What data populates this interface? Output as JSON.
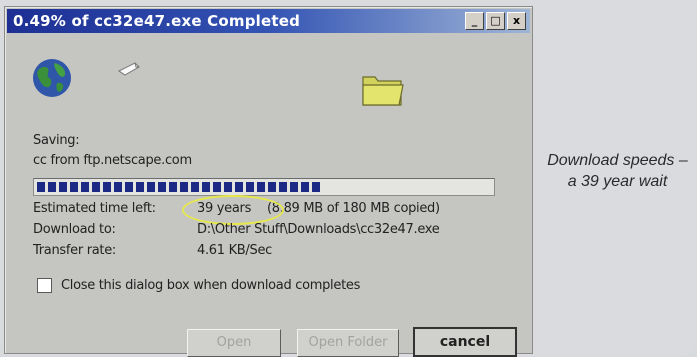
{
  "dialog": {
    "title": "0.49% of cc32e47.exe Completed",
    "window_buttons": [
      "_",
      "□",
      "x"
    ],
    "saving_label": "Saving:",
    "saving_source": "cc from ftp.netscape.com",
    "progress_fraction": 0.49,
    "fields": {
      "eta_label": "Estimated time left:",
      "eta_value": "39 years",
      "eta_detail": "(8.89 MB of 180 MB copied)",
      "download_to_label": "Download to:",
      "download_to_value": "D:\\Other Stuff\\Downloads\\cc32e47.exe",
      "transfer_rate_label": "Transfer rate:",
      "transfer_rate_value": "4.61 KB/Sec"
    },
    "checkbox": {
      "label": "Close this dialog box when download completes",
      "checked": false
    },
    "buttons": {
      "open": "Open",
      "open_folder": "Open Folder",
      "cancel": "cancel"
    },
    "icons": [
      "globe-icon",
      "document-icon",
      "folder-icon"
    ]
  },
  "caption": {
    "text": "Download speeds – a 39 year wait"
  },
  "colors": {
    "titlebar_start": "#1d2f94",
    "titlebar_end": "#9fb5d6",
    "progress": "#1c2a86",
    "highlight": "#e7e84a"
  }
}
